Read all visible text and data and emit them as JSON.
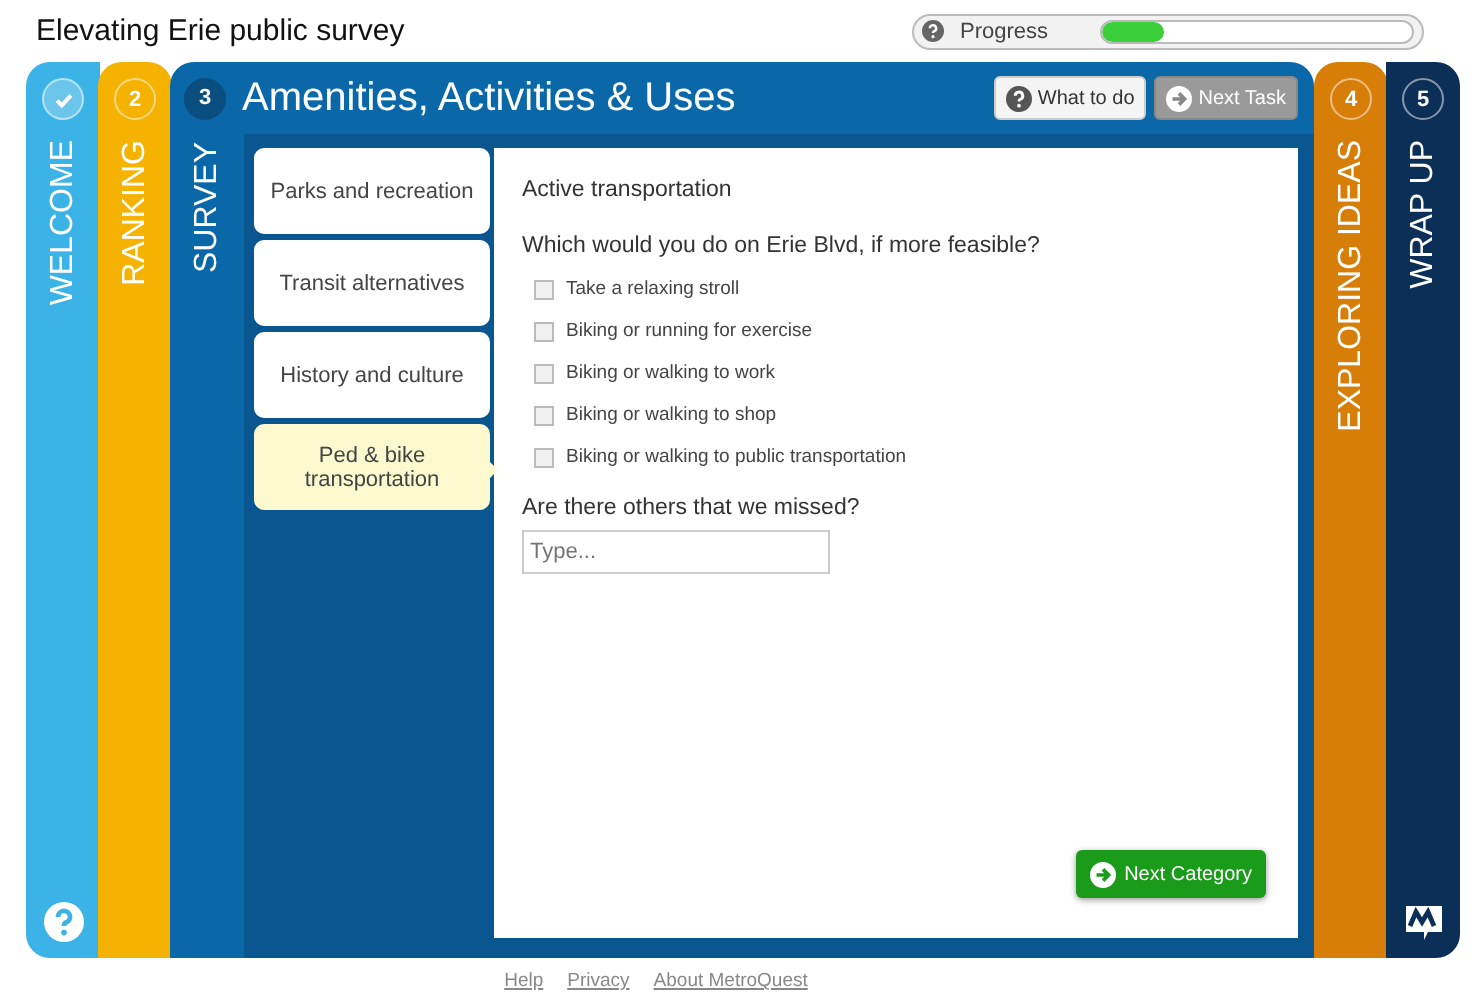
{
  "header": {
    "title": "Elevating Erie public survey",
    "progress_label": "Progress",
    "progress": {
      "level": 0.2
    }
  },
  "stages": [
    {
      "label": "WELCOME",
      "kind": "done",
      "color": "#3bb3e6"
    },
    {
      "label": "RANKING",
      "number": "2",
      "kind": "step",
      "color": "#f6b200"
    },
    {
      "label": "SURVEY",
      "number": "3",
      "kind": "active",
      "color": "#0b68a8"
    },
    {
      "label": "EXPLORING IDEAS",
      "number": "4",
      "kind": "step",
      "color": "#d77e08"
    },
    {
      "label": "WRAP UP",
      "number": "5",
      "kind": "step",
      "color": "#0c2f57"
    }
  ],
  "survey": {
    "title": "Amenities, Activities & Uses",
    "buttons": [
      {
        "label": "What to do",
        "kind": "help",
        "disabled": false
      },
      {
        "label": "Next Task",
        "kind": "next",
        "disabled": true
      }
    ],
    "categories": [
      {
        "label": "Parks and recreation",
        "selected": false
      },
      {
        "label": "Transit alternatives",
        "selected": false
      },
      {
        "label": "History and culture",
        "selected": false
      },
      {
        "label": "Ped & bike transportation",
        "selected": true
      }
    ],
    "heading": "Active transportation",
    "question": "Which would you do on Erie Blvd, if more feasible?",
    "options": [
      {
        "label": "Take a relaxing stroll",
        "checked": false
      },
      {
        "label": "Biking or running for exercise",
        "checked": false
      },
      {
        "label": "Biking or walking to work",
        "checked": false
      },
      {
        "label": "Biking or walking to shop",
        "checked": false
      },
      {
        "label": "Biking or walking to public transportation",
        "checked": false
      }
    ],
    "followup": "Are there others that we missed?",
    "input": {
      "placeholder": "Type..."
    },
    "next_button": "Next Category"
  },
  "footer_links": [
    "Help",
    "Privacy",
    "About MetroQuest"
  ]
}
